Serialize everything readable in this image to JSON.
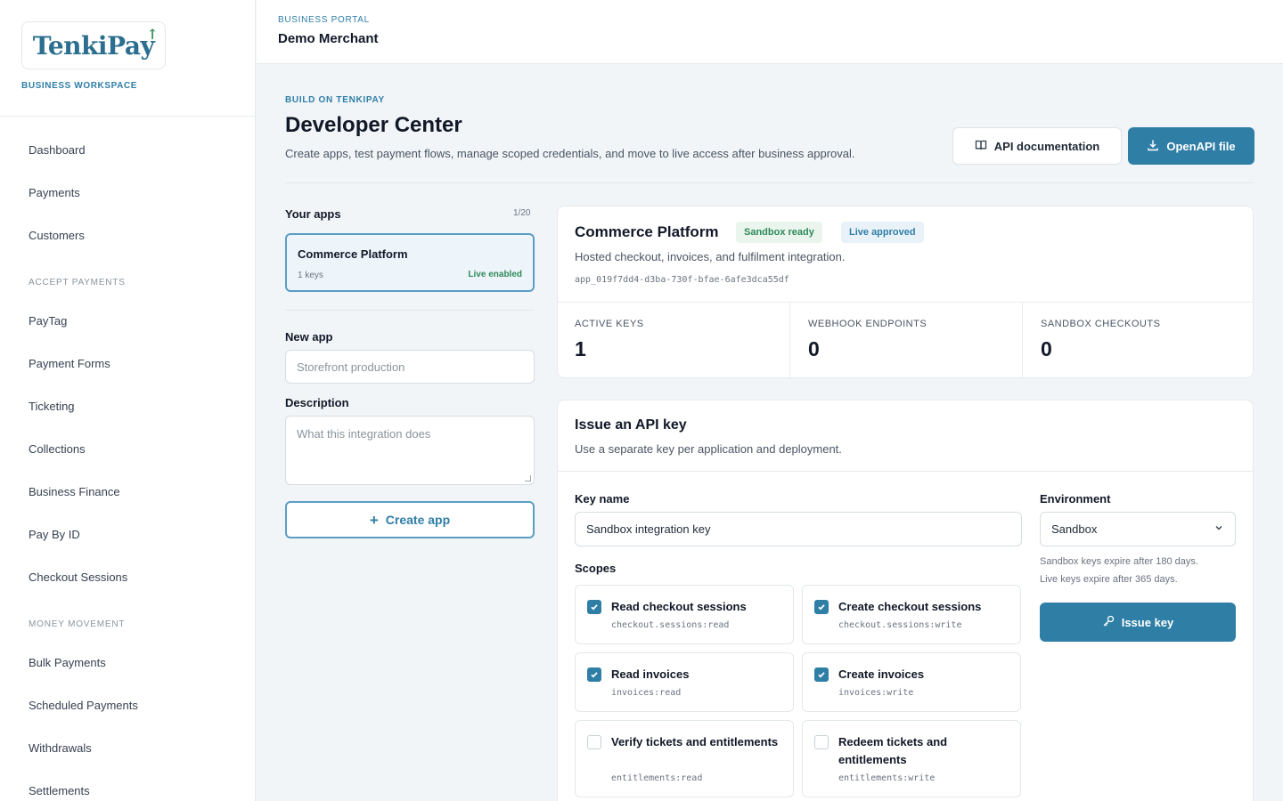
{
  "sidebar": {
    "brand": "TenkiPay",
    "workspace_label": "BUSINESS WORKSPACE",
    "items_top": [
      "Dashboard",
      "Payments",
      "Customers"
    ],
    "section_accept": "ACCEPT PAYMENTS",
    "items_accept": [
      "PayTag",
      "Payment Forms",
      "Ticketing",
      "Collections",
      "Business Finance",
      "Pay By ID",
      "Checkout Sessions"
    ],
    "section_money": "MONEY MOVEMENT",
    "items_money": [
      "Bulk Payments",
      "Scheduled Payments",
      "Withdrawals",
      "Settlements"
    ]
  },
  "header": {
    "portal_label": "BUSINESS PORTAL",
    "merchant": "Demo Merchant"
  },
  "page": {
    "eyebrow": "BUILD ON TENKIPAY",
    "title": "Developer Center",
    "subtitle": "Create apps, test payment flows, manage scoped credentials, and move to live access after business approval.",
    "api_docs_label": "API documentation",
    "openapi_label": "OpenAPI file"
  },
  "apps": {
    "title": "Your apps",
    "count": "1/20",
    "list": [
      {
        "name": "Commerce Platform",
        "keys": "1 keys",
        "status": "Live enabled"
      }
    ],
    "new_app_label": "New app",
    "new_app_placeholder": "Storefront production",
    "description_label": "Description",
    "description_placeholder": "What this integration does",
    "create_label": "Create app"
  },
  "app_detail": {
    "name": "Commerce Platform",
    "badge_sandbox": "Sandbox ready",
    "badge_live": "Live approved",
    "description": "Hosted checkout, invoices, and fulfilment integration.",
    "app_id": "app_019f7dd4-d3ba-730f-bfae-6afe3dca55df",
    "stats": [
      {
        "label": "ACTIVE KEYS",
        "value": "1"
      },
      {
        "label": "WEBHOOK ENDPOINTS",
        "value": "0"
      },
      {
        "label": "SANDBOX CHECKOUTS",
        "value": "0"
      }
    ]
  },
  "issue_key": {
    "title": "Issue an API key",
    "subtitle": "Use a separate key per application and deployment.",
    "key_name_label": "Key name",
    "key_name_value": "Sandbox integration key",
    "environment_label": "Environment",
    "environment_value": "Sandbox",
    "env_note_1": "Sandbox keys expire after 180 days.",
    "env_note_2": "Live keys expire after 365 days.",
    "scopes_label": "Scopes",
    "issue_label": "Issue key",
    "scopes": [
      {
        "title": "Read checkout sessions",
        "code": "checkout.sessions:read",
        "checked": true
      },
      {
        "title": "Create checkout sessions",
        "code": "checkout.sessions:write",
        "checked": true
      },
      {
        "title": "Read invoices",
        "code": "invoices:read",
        "checked": true
      },
      {
        "title": "Create invoices",
        "code": "invoices:write",
        "checked": true
      },
      {
        "title": "Verify tickets and entitlements",
        "code": "entitlements:read",
        "checked": false
      },
      {
        "title": "Redeem tickets and entitlements",
        "code": "entitlements:write",
        "checked": false
      }
    ]
  },
  "colors": {
    "accent": "#2f7ea6",
    "success": "#2f8a5a",
    "background": "#f1f5f7"
  }
}
